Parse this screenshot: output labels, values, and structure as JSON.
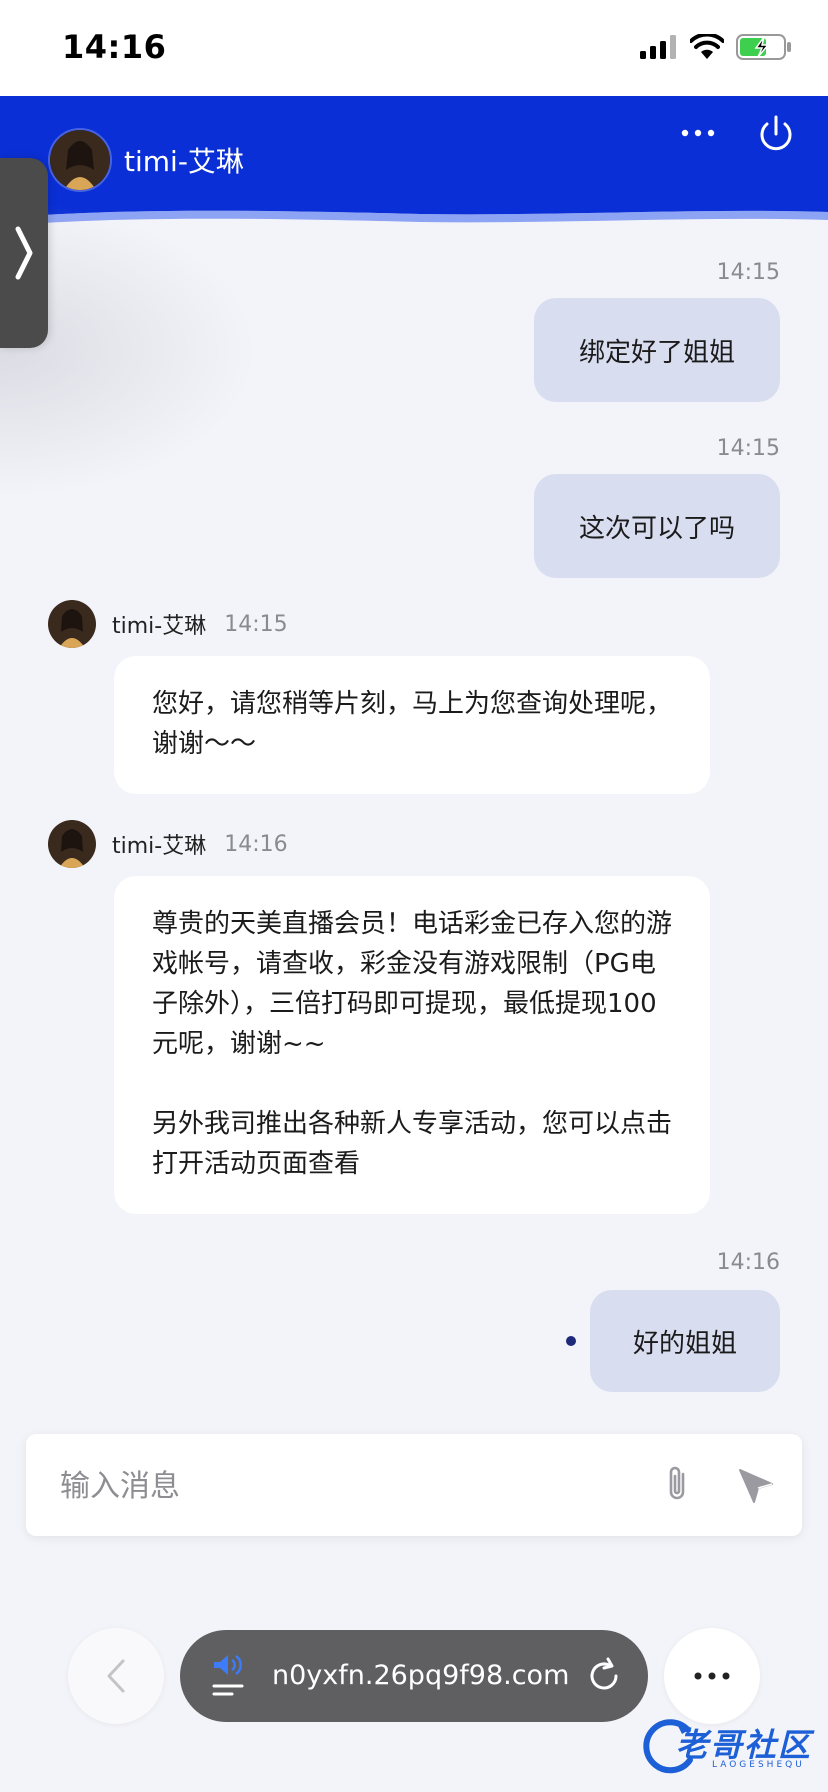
{
  "status_bar": {
    "time": "14:16"
  },
  "header": {
    "name": "timi-艾琳"
  },
  "messages": [
    {
      "side": "right",
      "time": "14:15",
      "text": "绑定好了姐姐"
    },
    {
      "side": "right",
      "time": "14:15",
      "text": "这次可以了吗"
    },
    {
      "side": "left",
      "name": "timi-艾琳",
      "time": "14:15",
      "text": "您好，请您稍等片刻，马上为您查询处理呢，谢谢～～"
    },
    {
      "side": "left",
      "name": "timi-艾琳",
      "time": "14:16",
      "text": "尊贵的天美直播会员！电话彩金已存入您的游戏帐号，请查收，彩金没有游戏限制（PG电子除外），三倍打码即可提现，最低提现100元呢，谢谢~~\n\n另外我司推出各种新人专享活动，您可以点击打开活动页面查看"
    },
    {
      "side": "right",
      "time": "14:16",
      "text": "好的姐姐"
    }
  ],
  "input": {
    "placeholder": "输入消息"
  },
  "browser": {
    "url": "n0yxfn.26pq9f98.com"
  },
  "watermark": {
    "text": "老哥社区",
    "sub": "LAOGESHEQU"
  },
  "colors": {
    "header": "#0a2fd6",
    "bubble_right": "#d9ddf0",
    "bubble_left": "#ffffff",
    "background": "#f3f4f9"
  }
}
